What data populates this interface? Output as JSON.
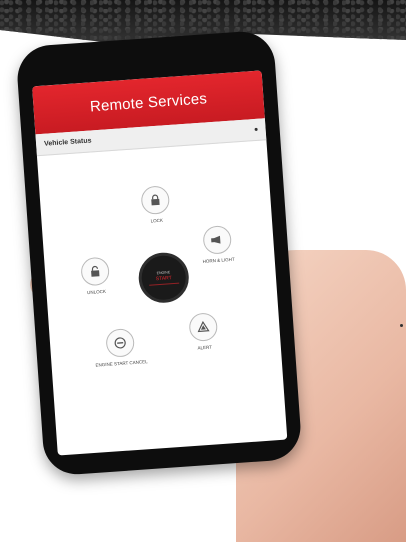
{
  "screen": {
    "title": "Remote Services",
    "status_label": "Vehicle Status",
    "controls": [
      {
        "label": "LOCK",
        "icon": "lock-icon"
      },
      {
        "label": "HORN & LIGHT",
        "icon": "horn-icon"
      },
      {
        "label": "UNLOCK",
        "icon": "unlock-icon"
      },
      {
        "label": "ENGINE START CANCEL",
        "icon": "stop-icon"
      },
      {
        "label": "ALERT",
        "icon": "hazard-icon"
      }
    ],
    "start_button": {
      "line1": "ENGINE",
      "line2": "START"
    }
  },
  "colors": {
    "accent": "#e3262d",
    "phone": "#0d0d0d"
  }
}
